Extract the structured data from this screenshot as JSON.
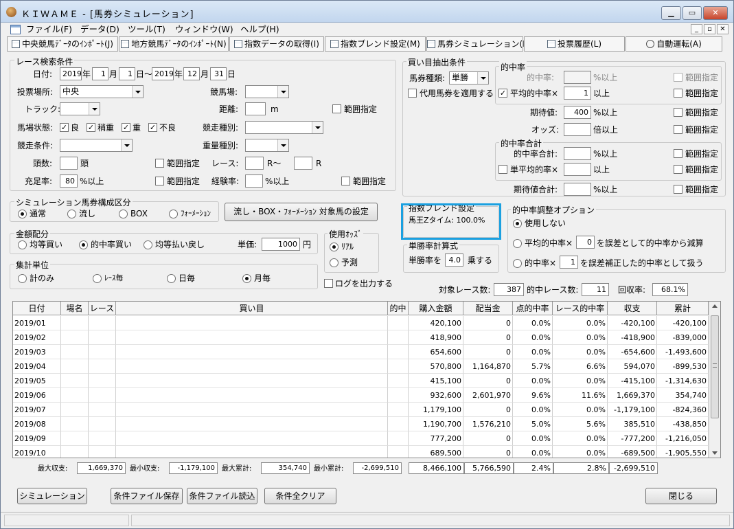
{
  "window": {
    "title": "ＫＩＷＡＭＥ - [馬券シミュレーション]"
  },
  "menu": [
    "ファイル(F)",
    "データ(D)",
    "ツール(T)",
    "ウィンドウ(W)",
    "ヘルプ(H)"
  ],
  "toolbar": [
    "中央競馬ﾃﾞｰﾀのｲﾝﾎﾟｰﾄ(J)",
    "地方競馬ﾃﾞｰﾀのｲﾝﾎﾟｰﾄ(N)",
    "指数データの取得(I)",
    "指数ブレンド設定(M)",
    "馬券シミュレーション(B)",
    "投票履歴(L)",
    "自動運転(A)"
  ],
  "race_search": {
    "legend": "レース検索条件",
    "date_label": "日付:",
    "from_year": "2019",
    "year1": "年",
    "from_month": "1",
    "month1": "月",
    "from_day": "1",
    "day_tilde": "日～",
    "to_year": "2019",
    "year2": "年",
    "to_month": "12",
    "month2": "月",
    "to_day": "31",
    "day2": "日",
    "venue_label": "投票場所:",
    "venue_value": "中央",
    "course_label": "競馬場:",
    "track_label": "トラック:",
    "distance_label": "距離:",
    "distance_unit": "m",
    "range_label": "範囲指定",
    "condition_label": "馬場状態:",
    "conds": [
      "良",
      "稍重",
      "重",
      "不良"
    ],
    "race_type_label": "競走種別:",
    "race_cond_label": "競走条件:",
    "weight_type_label": "重量種別:",
    "heads_label": "頭数:",
    "heads_unit": "頭",
    "race_label": "レース:",
    "race_r1": "R～",
    "race_r2": "R",
    "fill_label": "充足率:",
    "fill_value": "80",
    "fill_unit": "%以上",
    "exp_label": "経験率:",
    "exp_unit": "%以上"
  },
  "sim_type": {
    "legend": "シミュレーション馬券構成区分",
    "options": [
      "通常",
      "流し",
      "BOX",
      "ﾌｫｰﾒｰｼｮﾝ"
    ],
    "selected": 0,
    "setup_button": "流し・BOX・ﾌｫｰﾒｰｼｮﾝ 対象馬の設定"
  },
  "amount": {
    "legend": "金額配分",
    "options": [
      "均等買い",
      "的中率買い",
      "均等払い戻し"
    ],
    "selected": 1,
    "unit_label": "単価:",
    "unit_value": "1000",
    "unit_yen": "円"
  },
  "odds": {
    "legend": "使用ｵｯｽﾞ",
    "options": [
      "ﾘｱﾙ",
      "予測"
    ],
    "selected": 0
  },
  "aggregate": {
    "legend": "集計単位",
    "options": [
      "計のみ",
      "ﾚｰｽ毎",
      "日毎",
      "月毎"
    ],
    "selected": 3
  },
  "log_label": "ログを出力する",
  "buy": {
    "legend": "買い目抽出条件",
    "ticket_label": "馬券種類:",
    "ticket_value": "単勝",
    "substitute_label": "代用馬券を適用する",
    "hit_legend": "的中率",
    "hit_label": "的中率:",
    "hit_unit": "%以上",
    "avg_hit_label": "平均的中率×",
    "avg_hit_value": "1",
    "avg_hit_unit": "以上",
    "expect_label": "期待値:",
    "expect_value": "400",
    "expect_unit": "%以上",
    "odds_label": "オッズ:",
    "odds_unit": "倍以上",
    "hit_sum_legend": "的中率合計",
    "hit_sum_label": "的中率合計:",
    "hit_sum_unit": "%以上",
    "single_avg_label": "単平均的率×",
    "single_avg_unit": "以上",
    "expect_sum_label": "期待値合計:",
    "expect_sum_unit": "%以上",
    "range_label": "範囲指定"
  },
  "blend": {
    "legend": "指数ブレンド設定",
    "text": "馬王Zタイム: 100.0%"
  },
  "win_calc": {
    "legend": "単勝率計算式",
    "label": "単勝率を",
    "value": "4.0",
    "unit": "乗する"
  },
  "adjust": {
    "legend": "的中率調整オプション",
    "opt1": "使用しない",
    "opt2a": "平均的中率×",
    "opt2_value": "0",
    "opt2b": "を誤差として的中率から減算",
    "opt3a": "的中率×",
    "opt3_value": "1",
    "opt3b": "を誤差補正した的中率として扱う",
    "selected": 0
  },
  "summary": {
    "races_label": "対象レース数:",
    "races": "387",
    "hits_label": "的中レース数:",
    "hits": "11",
    "recovery_label": "回収率:",
    "recovery": "68.1%"
  },
  "table": {
    "headers": [
      "日付",
      "場名",
      "レース",
      "買い目",
      "的中",
      "購入金額",
      "配当金",
      "点的中率",
      "レース的中率",
      "収支",
      "累計"
    ],
    "rows": [
      [
        "2019/01",
        "",
        "",
        "",
        "",
        "420,100",
        "0",
        "0.0%",
        "0.0%",
        "-420,100",
        "-420,100"
      ],
      [
        "2019/02",
        "",
        "",
        "",
        "",
        "418,900",
        "0",
        "0.0%",
        "0.0%",
        "-418,900",
        "-839,000"
      ],
      [
        "2019/03",
        "",
        "",
        "",
        "",
        "654,600",
        "0",
        "0.0%",
        "0.0%",
        "-654,600",
        "-1,493,600"
      ],
      [
        "2019/04",
        "",
        "",
        "",
        "",
        "570,800",
        "1,164,870",
        "5.7%",
        "6.6%",
        "594,070",
        "-899,530"
      ],
      [
        "2019/05",
        "",
        "",
        "",
        "",
        "415,100",
        "0",
        "0.0%",
        "0.0%",
        "-415,100",
        "-1,314,630"
      ],
      [
        "2019/06",
        "",
        "",
        "",
        "",
        "932,600",
        "2,601,970",
        "9.6%",
        "11.6%",
        "1,669,370",
        "354,740"
      ],
      [
        "2019/07",
        "",
        "",
        "",
        "",
        "1,179,100",
        "0",
        "0.0%",
        "0.0%",
        "-1,179,100",
        "-824,360"
      ],
      [
        "2019/08",
        "",
        "",
        "",
        "",
        "1,190,700",
        "1,576,210",
        "5.0%",
        "5.6%",
        "385,510",
        "-438,850"
      ],
      [
        "2019/09",
        "",
        "",
        "",
        "",
        "777,200",
        "0",
        "0.0%",
        "0.0%",
        "-777,200",
        "-1,216,050"
      ],
      [
        "2019/10",
        "",
        "",
        "",
        "",
        "689,500",
        "0",
        "0.0%",
        "0.0%",
        "-689,500",
        "-1,905,550"
      ]
    ]
  },
  "totals": {
    "max_income_label": "最大収支:",
    "max_income": "1,669,370",
    "min_income_label": "最小収支:",
    "min_income": "-1,179,100",
    "max_cum_label": "最大累計:",
    "max_cum": "354,740",
    "min_cum_label": "最小累計:",
    "min_cum": "-2,699,510",
    "purchase": "8,466,100",
    "payout": "5,766,590",
    "point_hit": "2.4%",
    "race_hit": "2.8%",
    "balance": "-2,699,510"
  },
  "buttons": {
    "simulate": "シミュレーション",
    "save": "条件ファイル保存",
    "load": "条件ファイル読込",
    "clear": "条件全クリア",
    "close": "閉じる"
  }
}
